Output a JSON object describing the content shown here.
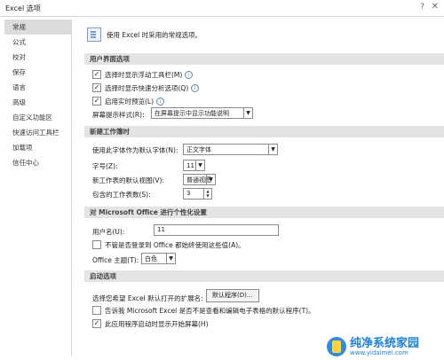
{
  "window": {
    "title": "Excel 选项",
    "help": "?",
    "close": "✕"
  },
  "sidebar": {
    "items": [
      {
        "label": "常规"
      },
      {
        "label": "公式"
      },
      {
        "label": "校对"
      },
      {
        "label": "保存"
      },
      {
        "label": "语言"
      },
      {
        "label": "高级"
      },
      {
        "label": "自定义功能区"
      },
      {
        "label": "快速访问工具栏"
      },
      {
        "label": "加载项"
      },
      {
        "label": "信任中心"
      }
    ]
  },
  "intro": {
    "text": "使用 Excel 时采用的常规选项。"
  },
  "ui_options": {
    "heading": "用户界面选项",
    "mini_toolbar": "选择时显示浮动工具栏(M)",
    "quick_analysis": "选择时显示快速分析选项(Q)",
    "live_preview": "启用实时预览(L)",
    "screentip_label": "屏幕提示样式(R):",
    "screentip_value": "在屏幕提示中显示功能说明"
  },
  "new_workbook": {
    "heading": "新建工作簿时",
    "font_label": "使用此字体作为默认字体(N):",
    "font_value": "正文字体",
    "size_label": "字号(Z):",
    "size_value": "11",
    "view_label": "新工作表的默认视图(V):",
    "view_value": "普通视图",
    "sheets_label": "包含的工作表数(S):",
    "sheets_value": "3"
  },
  "personalize": {
    "heading": "对 Microsoft Office 进行个性化设置",
    "username_label": "用户名(U):",
    "username_value": "11",
    "always_use": "不管是否登录到 Office 都始终使用这些值(A)。",
    "theme_label": "Office 主题(T):",
    "theme_value": "白色"
  },
  "startup": {
    "heading": "启动选项",
    "ext_label": "选择您希望 Excel 默认打开的扩展名:",
    "default_programs": "默认程序(D)...",
    "tell_me": "告诉我 Microsoft Excel 是否不是查看和编辑电子表格的默认程序(T)。",
    "show_start": "此应用程序启动时显示开始屏幕(H)"
  },
  "watermark": {
    "name": "纯净系统家园",
    "url": "www.yidaimei.com"
  }
}
